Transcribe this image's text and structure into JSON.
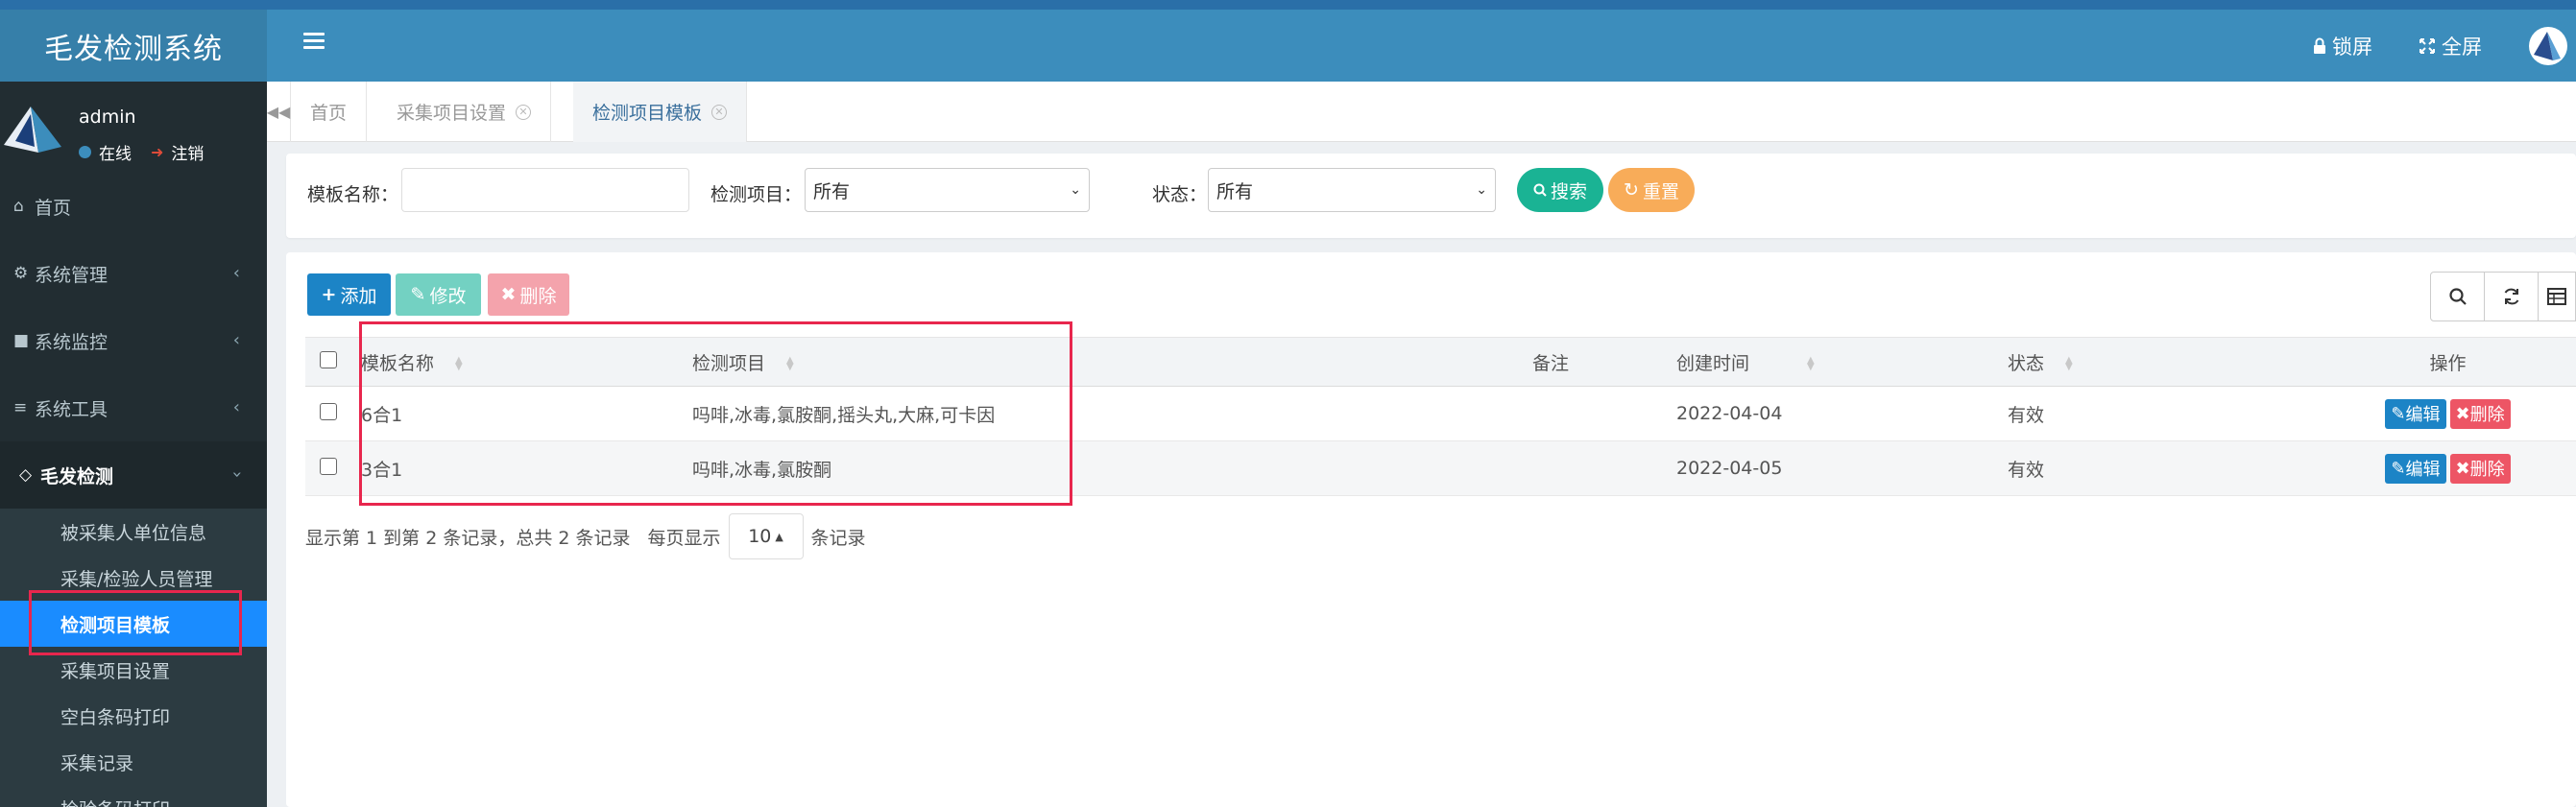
{
  "app": {
    "title": "毛发检测系统"
  },
  "topbar": {
    "lock_label": "锁屏",
    "fullscreen_label": "全屏"
  },
  "user": {
    "name": "admin",
    "status": "在线",
    "logout": "注销"
  },
  "sidebar": {
    "items": [
      {
        "label": "首页",
        "icon": "home-icon"
      },
      {
        "label": "系统管理",
        "icon": "gear-icon"
      },
      {
        "label": "系统监控",
        "icon": "video-icon"
      },
      {
        "label": "系统工具",
        "icon": "bars-icon"
      },
      {
        "label": "毛发检测",
        "icon": "diamond-icon"
      }
    ],
    "sub_items": [
      {
        "label": "被采集人单位信息"
      },
      {
        "label": "采集/检验人员管理"
      },
      {
        "label": "检测项目模板"
      },
      {
        "label": "采集项目设置"
      },
      {
        "label": "空白条码打印"
      },
      {
        "label": "采集记录"
      },
      {
        "label": "检验条码打印"
      }
    ]
  },
  "tabs": [
    {
      "label": "首页"
    },
    {
      "label": "采集项目设置"
    },
    {
      "label": "检测项目模板"
    }
  ],
  "search": {
    "name_label": "模板名称：",
    "name_value": "",
    "item_label": "检测项目：",
    "item_value": "所有",
    "status_label": "状态：",
    "status_value": "所有",
    "search_btn": "搜索",
    "reset_btn": "重置"
  },
  "toolbar": {
    "add": "添加",
    "edit": "修改",
    "delete": "删除"
  },
  "table": {
    "headers": [
      "模板名称",
      "检测项目",
      "备注",
      "创建时间",
      "状态",
      "操作"
    ],
    "rows": [
      {
        "name": "6合1",
        "items": "吗啡,冰毒,氯胺酮,摇头丸,大麻,可卡因",
        "remark": "",
        "created": "2022-04-04",
        "status": "有效"
      },
      {
        "name": "3合1",
        "items": "吗啡,冰毒,氯胺酮",
        "remark": "",
        "created": "2022-04-05",
        "status": "有效"
      }
    ],
    "edit_label": "编辑",
    "delete_label": "删除"
  },
  "pager": {
    "summary": "显示第 1 到第 2 条记录，总共 2 条记录",
    "per_page_prefix": "每页显示",
    "per_page": "10",
    "per_page_suffix": "条记录"
  },
  "colors": {
    "topbar": "#3c8dbc",
    "sidebar": "#222d32",
    "active": "#1a8cff",
    "search_btn": "#1ab394",
    "reset_btn": "#f8ac59",
    "add_btn": "#1c84c6",
    "edit_btn": "#73d1c2",
    "delete_btn": "#f4a3ac",
    "highlight": "#e8264d"
  }
}
